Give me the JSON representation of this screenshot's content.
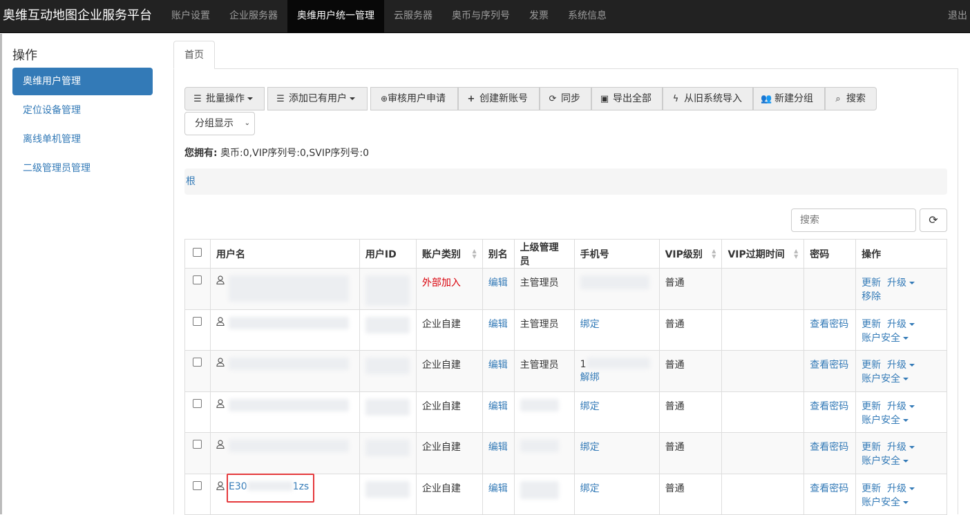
{
  "brand": "奥维互动地图企业服务平台",
  "nav": {
    "items": [
      {
        "label": "账户设置"
      },
      {
        "label": "企业服务器"
      },
      {
        "label": "奥维用户统一管理"
      },
      {
        "label": "云服务器"
      },
      {
        "label": "奥币与序列号"
      },
      {
        "label": "发票"
      },
      {
        "label": "系统信息"
      }
    ],
    "active_index": 2,
    "logout": "退出"
  },
  "sidebar": {
    "title": "操作",
    "items": [
      {
        "label": "奥维用户管理"
      },
      {
        "label": "定位设备管理"
      },
      {
        "label": "离线单机管理"
      },
      {
        "label": "二级管理员管理"
      }
    ]
  },
  "tabs": {
    "home": "首页"
  },
  "toolbar": {
    "batch": "批量操作",
    "add_existing": "添加已有用户",
    "review": "审核用户申请",
    "create": "创建新账号",
    "sync": "同步",
    "export": "导出全部",
    "import_old": "从旧系统导入",
    "new_group": "新建分组",
    "search": "搜索"
  },
  "group_select": {
    "value": "分组显示"
  },
  "owned": {
    "label": "您拥有:",
    "value": "奥币:0,VIP序列号:0,SVIP序列号:0"
  },
  "breadcrumb": "根",
  "search": {
    "placeholder": "搜索"
  },
  "table": {
    "headers": {
      "username": "用户名",
      "user_id": "用户ID",
      "account_type": "账户类别",
      "alias": "别名",
      "manager": "上级管理员",
      "phone": "手机号",
      "vip_level": "VIP级别",
      "vip_expire": "VIP过期时间",
      "password": "密码",
      "actions": "操作"
    },
    "rows": [
      {
        "account_type": "外部加入",
        "alias": "编辑",
        "manager": "主管理员",
        "phone_prefix": "",
        "phone_action": "",
        "vip": "普通",
        "password": "",
        "action1": "更新",
        "action2": "升级",
        "action3": "移除"
      },
      {
        "account_type": "企业自建",
        "alias": "编辑",
        "manager": "主管理员",
        "phone_prefix": "",
        "phone_action": "绑定",
        "vip": "普通",
        "password": "查看密码",
        "action1": "更新",
        "action2": "升级",
        "action3": "账户安全"
      },
      {
        "account_type": "企业自建",
        "alias": "编辑",
        "manager": "主管理员",
        "phone_prefix": "1",
        "phone_action": "解绑",
        "vip": "普通",
        "password": "查看密码",
        "action1": "更新",
        "action2": "升级",
        "action3": "账户安全"
      },
      {
        "account_type": "企业自建",
        "alias": "编辑",
        "manager": "",
        "phone_prefix": "",
        "phone_action": "绑定",
        "vip": "普通",
        "password": "查看密码",
        "action1": "更新",
        "action2": "升级",
        "action3": "账户安全"
      },
      {
        "account_type": "企业自建",
        "alias": "编辑",
        "manager": "",
        "phone_prefix": "",
        "phone_action": "绑定",
        "vip": "普通",
        "password": "查看密码",
        "action1": "更新",
        "action2": "升级",
        "action3": "账户安全"
      },
      {
        "username_start": "E30",
        "username_end": "1zs",
        "account_type": "企业自建",
        "alias": "编辑",
        "manager": "",
        "phone_prefix": "",
        "phone_action": "绑定",
        "vip": "普通",
        "password": "查看密码",
        "action1": "更新",
        "action2": "升级",
        "action3": "账户安全"
      }
    ]
  }
}
